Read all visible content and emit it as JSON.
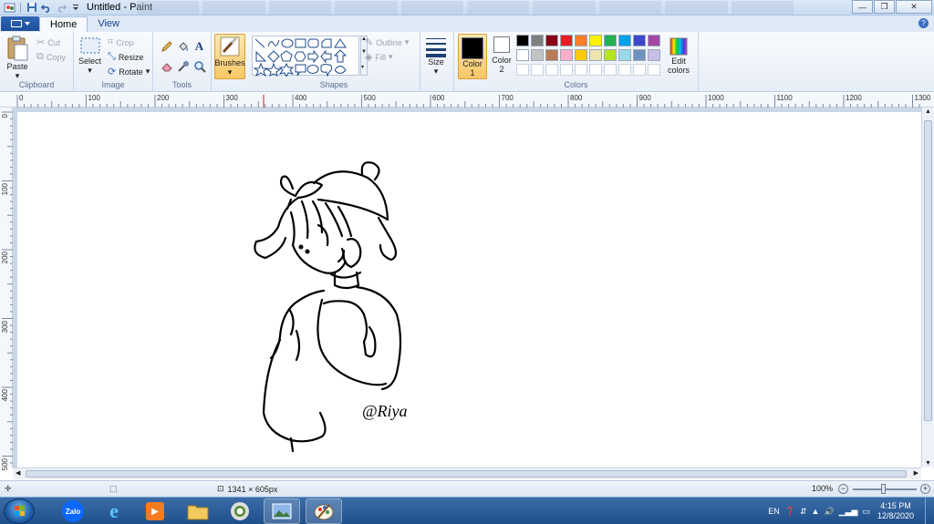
{
  "window": {
    "title": "Untitled - Paint",
    "controls": [
      "minimize-icon",
      "maximize-icon",
      "close-icon"
    ]
  },
  "ribbon_tabs": [
    {
      "label": "Home",
      "active": true
    },
    {
      "label": "View",
      "active": false
    }
  ],
  "clipboard": {
    "group_label": "Clipboard",
    "paste": "Paste",
    "cut": "Cut",
    "copy": "Copy"
  },
  "image": {
    "group_label": "Image",
    "select": "Select",
    "crop": "Crop",
    "resize": "Resize",
    "rotate": "Rotate"
  },
  "tools": {
    "group_label": "Tools",
    "items": [
      "pencil-icon",
      "fill-icon",
      "text-icon",
      "eraser-icon",
      "color-picker-icon",
      "magnifier-icon"
    ]
  },
  "brushes": {
    "label": "Brushes"
  },
  "shapes": {
    "group_label": "Shapes",
    "outline": "Outline",
    "fill": "Fill"
  },
  "size": {
    "label": "Size"
  },
  "colors": {
    "group_label": "Colors",
    "color1_label": "Color",
    "color1_num": "1",
    "color2_label": "Color",
    "color2_num": "2",
    "edit_label_1": "Edit",
    "edit_label_2": "colors",
    "color1": "#000000",
    "color2": "#ffffff",
    "palette_row1": [
      "#000000",
      "#7f7f7f",
      "#880015",
      "#ed1c24",
      "#ff7f27",
      "#fff200",
      "#22b14c",
      "#00a2e8",
      "#3f48cc",
      "#a349a4"
    ],
    "palette_row2": [
      "#ffffff",
      "#c3c3c3",
      "#b97a57",
      "#ffaec9",
      "#ffc90e",
      "#efe4b0",
      "#b5e61d",
      "#99d9ea",
      "#7092be",
      "#c8bfe7"
    ],
    "palette_row3": [
      "#ffffff",
      "#ffffff",
      "#ffffff",
      "#ffffff",
      "#ffffff",
      "#ffffff",
      "#ffffff",
      "#ffffff",
      "#ffffff",
      "#ffffff"
    ]
  },
  "ruler": {
    "h_labels": [
      "0",
      "100",
      "200",
      "300",
      "400",
      "500",
      "600",
      "700",
      "800",
      "900",
      "1000",
      "1100",
      "1200",
      "1300"
    ],
    "v_labels": [
      "0",
      "100",
      "200",
      "300",
      "400",
      "500"
    ]
  },
  "canvas": {
    "signature": "@Riya"
  },
  "status": {
    "dimensions": "1341 × 605px",
    "zoom": "100%"
  },
  "taskbar": {
    "apps": [
      "zalo-icon",
      "internet-explorer-icon",
      "media-player-icon",
      "file-explorer-icon",
      "chrome-icon",
      "image-viewer-icon",
      "paint-icon"
    ],
    "zalo_label": "Zalo",
    "language": "EN",
    "time": "4:15 PM",
    "date": "12/8/2020"
  }
}
